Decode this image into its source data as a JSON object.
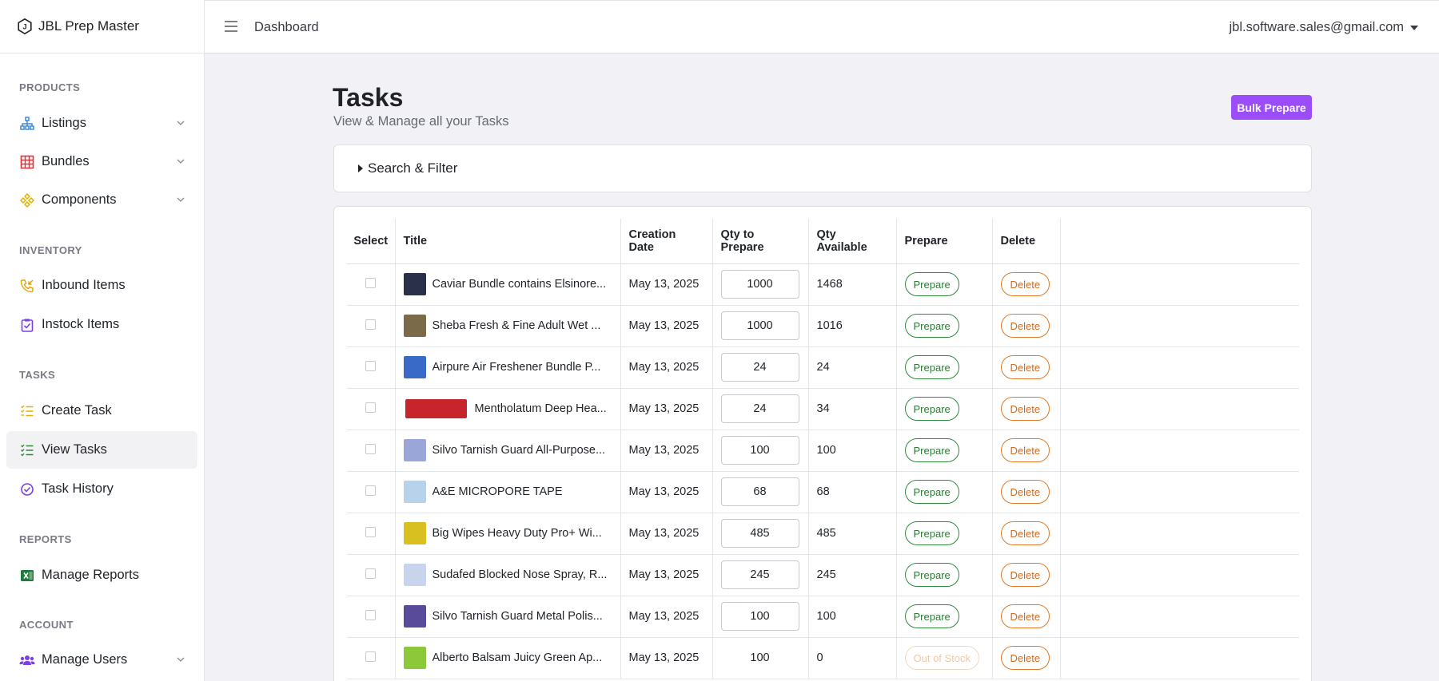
{
  "app": {
    "name": "JBL Prep Master"
  },
  "header": {
    "breadcrumb": "Dashboard",
    "user_email": "jbl.software.sales@gmail.com"
  },
  "sidebar": {
    "sections": {
      "products": "PRODUCTS",
      "inventory": "INVENTORY",
      "tasks": "TASKS",
      "reports": "REPORTS",
      "account": "ACCOUNT"
    },
    "items": {
      "listings": {
        "label": "Listings",
        "icon": "sitemap-icon",
        "color": "#3d8bd9"
      },
      "bundles": {
        "label": "Bundles",
        "icon": "grid-icon",
        "color": "#d9343a"
      },
      "components": {
        "label": "Components",
        "icon": "components-icon",
        "color": "#e0b400"
      },
      "inbound": {
        "label": "Inbound Items",
        "icon": "inbound-phone-icon",
        "color": "#e0a400"
      },
      "instock": {
        "label": "Instock Items",
        "icon": "clipboard-check-icon",
        "color": "#7b3fe4"
      },
      "create_task": {
        "label": "Create Task",
        "icon": "list-icon",
        "color": "#e0b400"
      },
      "view_tasks": {
        "label": "View Tasks",
        "icon": "checklist-icon",
        "color": "#2f8a3e"
      },
      "task_history": {
        "label": "Task History",
        "icon": "check-circle-icon",
        "color": "#7b3fe4"
      },
      "manage_reports": {
        "label": "Manage Reports",
        "icon": "excel-icon",
        "color": "#1f7a3d"
      },
      "manage_users": {
        "label": "Manage Users",
        "icon": "users-icon",
        "color": "#7b3fe4"
      }
    }
  },
  "page": {
    "title": "Tasks",
    "subtitle": "View & Manage all your Tasks",
    "bulk_button": "Bulk Prepare",
    "filter_label": "Search & Filter"
  },
  "table": {
    "headers": {
      "select": "Select",
      "title": "Title",
      "creation_date": "Creation Date",
      "qty_to_prepare": "Qty to Prepare",
      "qty_available": "Qty Available",
      "prepare": "Prepare",
      "delete": "Delete"
    },
    "rows": [
      {
        "title": "Caviar Bundle contains Elsinore...",
        "date": "May 13, 2025",
        "qty_prepare": "1000",
        "qty_available": "1468",
        "action": "Prepare",
        "delete": "Delete",
        "thumb": "#2a2f4a"
      },
      {
        "title": "Sheba Fresh & Fine Adult Wet ...",
        "date": "May 13, 2025",
        "qty_prepare": "1000",
        "qty_available": "1016",
        "action": "Prepare",
        "delete": "Delete",
        "thumb": "#7a6a4a"
      },
      {
        "title": "Airpure Air Freshener Bundle P...",
        "date": "May 13, 2025",
        "qty_prepare": "24",
        "qty_available": "24",
        "action": "Prepare",
        "delete": "Delete",
        "thumb": "#3a6ac8"
      },
      {
        "title": "Mentholatum Deep Hea...",
        "date": "May 13, 2025",
        "qty_prepare": "24",
        "qty_available": "34",
        "action": "Prepare",
        "delete": "Delete",
        "thumb": "#c8242c"
      },
      {
        "title": "Silvo Tarnish Guard All-Purpose...",
        "date": "May 13, 2025",
        "qty_prepare": "100",
        "qty_available": "100",
        "action": "Prepare",
        "delete": "Delete",
        "thumb": "#9aa6d8"
      },
      {
        "title": "A&E MICROPORE TAPE",
        "date": "May 13, 2025",
        "qty_prepare": "68",
        "qty_available": "68",
        "action": "Prepare",
        "delete": "Delete",
        "thumb": "#b8d2ec"
      },
      {
        "title": "Big Wipes Heavy Duty Pro+ Wi...",
        "date": "May 13, 2025",
        "qty_prepare": "485",
        "qty_available": "485",
        "action": "Prepare",
        "delete": "Delete",
        "thumb": "#d8c020"
      },
      {
        "title": "Sudafed Blocked Nose Spray, R...",
        "date": "May 13, 2025",
        "qty_prepare": "245",
        "qty_available": "245",
        "action": "Prepare",
        "delete": "Delete",
        "thumb": "#c8d4ec"
      },
      {
        "title": "Silvo Tarnish Guard Metal Polis...",
        "date": "May 13, 2025",
        "qty_prepare": "100",
        "qty_available": "100",
        "action": "Prepare",
        "delete": "Delete",
        "thumb": "#5a4a9a"
      },
      {
        "title": "Alberto Balsam Juicy Green Ap...",
        "date": "May 13, 2025",
        "qty_prepare": "100",
        "qty_available": "0",
        "action": "Out of Stock",
        "delete": "Delete",
        "thumb": "#8cc83a",
        "out_of_stock": true
      }
    ]
  }
}
